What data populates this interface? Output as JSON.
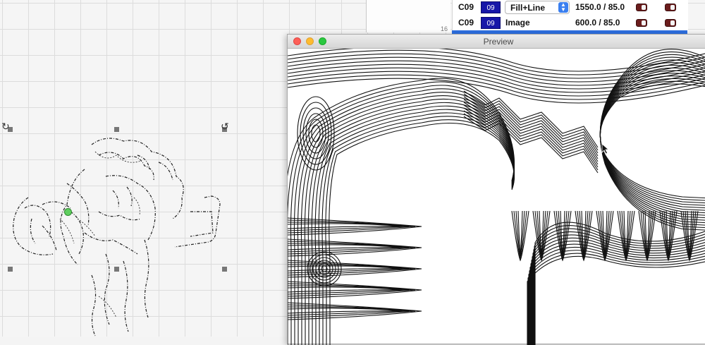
{
  "top": {
    "row_number": "16"
  },
  "layers": [
    {
      "name": "C09",
      "swatch": "09",
      "mode": "Fill+Line",
      "mode_is_select": true,
      "speed_power": "1550.0 / 85.0"
    },
    {
      "name": "C09",
      "swatch": "09",
      "mode": "Image",
      "mode_is_select": false,
      "speed_power": "600.0 / 85.0"
    }
  ],
  "preview": {
    "title": "Preview"
  },
  "colors": {
    "layer_swatch": "#1717a8",
    "toggle_on": "#6b1d1d",
    "selection_bar": "#2d6fe0",
    "origin_marker": "#5fce5f"
  },
  "icons": [
    "rotate-handle-icon",
    "chevron-updown-icon",
    "pointer-cursor-icon"
  ]
}
